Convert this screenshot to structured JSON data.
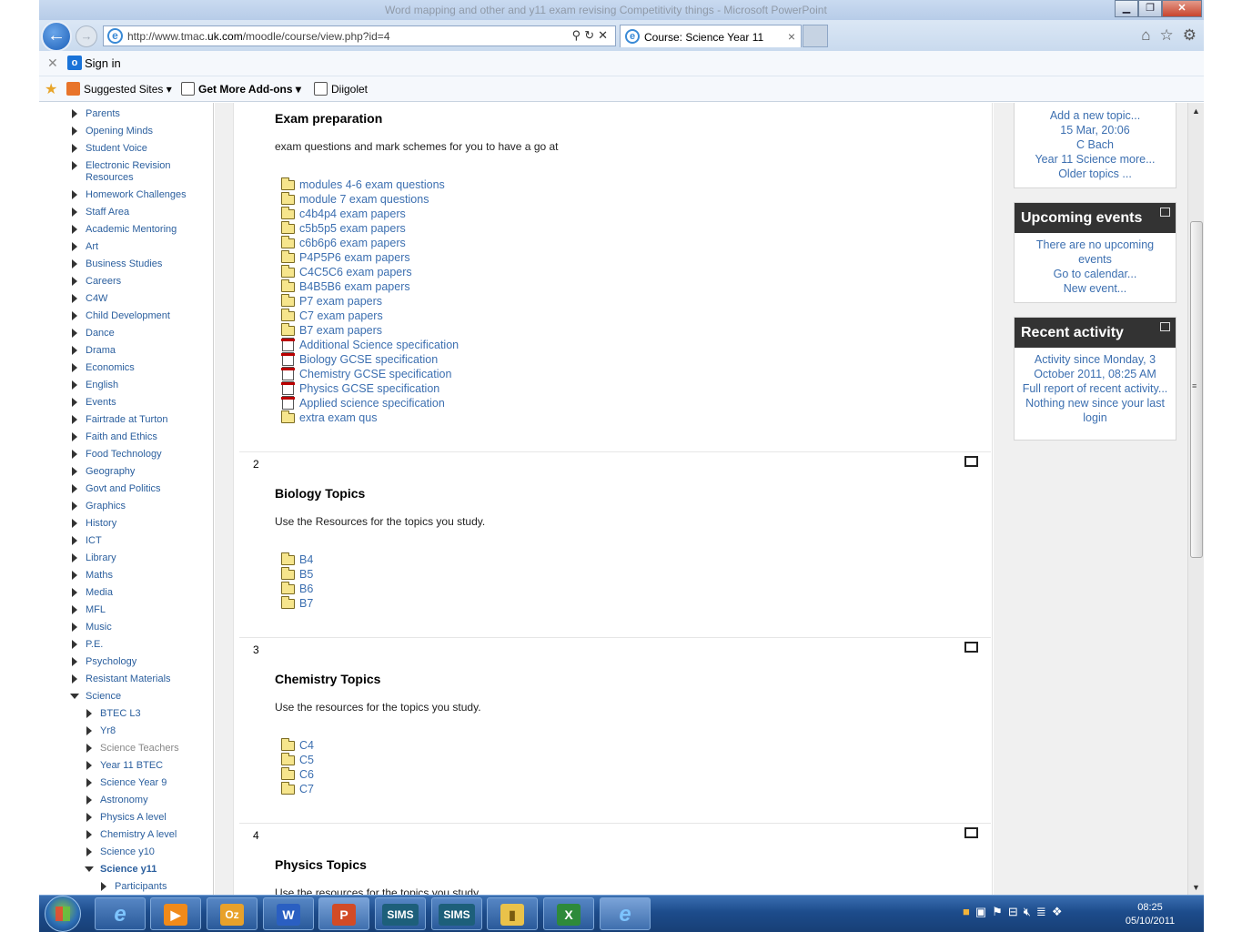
{
  "window": {
    "title": "Word mapping and other and y11 exam revising Competitivity things - Microsoft PowerPoint"
  },
  "browser": {
    "url_prefix": "http://www.tmac.",
    "url_domain": "uk.com",
    "url_suffix": "/moodle/course/view.php?id=4",
    "tab_label": "Course: Science Year 11"
  },
  "signin": {
    "label": "Sign in"
  },
  "favorites": {
    "suggested": "Suggested Sites",
    "addons": "Get More Add-ons",
    "diigolet": "Diigolet"
  },
  "sidebar": {
    "items": [
      "Parents",
      "Opening Minds",
      "Student Voice",
      "Electronic Revision",
      "Resources",
      "Homework Challenges",
      "Staff Area",
      "Academic Mentoring",
      "Art",
      "Business Studies",
      "Careers",
      "C4W",
      "Child Development",
      "Dance",
      "Drama",
      "Economics",
      "English",
      "Events",
      "Fairtrade at Turton",
      "Faith and Ethics",
      "Food Technology",
      "Geography",
      "Govt and Politics",
      "Graphics",
      "History",
      "ICT",
      "Library",
      "Maths",
      "Media",
      "MFL",
      "Music",
      "P.E.",
      "Psychology",
      "Resistant Materials",
      "Science"
    ],
    "science_children": [
      "BTEC L3",
      "Yr8",
      "Science Teachers",
      "Year 11 BTEC",
      "Science Year 9",
      "Astronomy",
      "Physics A level",
      "Chemistry A level",
      "Science y10",
      "Science y11"
    ],
    "y11_children": [
      "Participants"
    ]
  },
  "sections": {
    "exam": {
      "title": "Exam preparation",
      "desc": "exam questions and mark schemes for you to have a go at",
      "resources": [
        {
          "label": "modules 4-6 exam questions",
          "icon": "folder"
        },
        {
          "label": "module 7 exam questions",
          "icon": "folder"
        },
        {
          "label": "c4b4p4 exam papers",
          "icon": "folder"
        },
        {
          "label": "c5b5p5 exam papers",
          "icon": "folder"
        },
        {
          "label": "c6b6p6 exam papers",
          "icon": "folder"
        },
        {
          "label": "P4P5P6 exam papers",
          "icon": "folder"
        },
        {
          "label": "C4C5C6 exam papers",
          "icon": "folder"
        },
        {
          "label": "B4B5B6 exam papers",
          "icon": "folder"
        },
        {
          "label": "P7 exam papers",
          "icon": "folder"
        },
        {
          "label": "C7 exam papers",
          "icon": "folder"
        },
        {
          "label": "B7 exam papers",
          "icon": "folder"
        },
        {
          "label": "Additional Science specification",
          "icon": "pdf"
        },
        {
          "label": "Biology GCSE specification",
          "icon": "pdf"
        },
        {
          "label": "Chemistry GCSE specification",
          "icon": "pdf"
        },
        {
          "label": "Physics GCSE specification",
          "icon": "pdf"
        },
        {
          "label": "Applied science specification",
          "icon": "pdf"
        },
        {
          "label": "extra exam qus",
          "icon": "folder"
        }
      ]
    },
    "biology": {
      "number": "2",
      "title": "Biology Topics",
      "desc": "Use the Resources for the topics you study.",
      "resources": [
        "B4",
        "B5",
        "B6",
        "B7"
      ]
    },
    "chemistry": {
      "number": "3",
      "title": "Chemistry Topics",
      "desc": "Use the resources for the topics you study.",
      "resources": [
        "C4",
        "C5",
        "C6",
        "C7"
      ]
    },
    "physics": {
      "number": "4",
      "title": "Physics Topics",
      "desc": "Use the resources for the topics you study."
    }
  },
  "blocks": {
    "news": {
      "lines": [
        "Add a new topic...",
        "15 Mar, 20:06",
        "C Bach",
        "Year 11 Science more...",
        "Older topics ..."
      ]
    },
    "upcoming": {
      "title": "Upcoming events",
      "lines": [
        "There are no upcoming",
        "events",
        "Go to calendar...",
        "New event..."
      ]
    },
    "recent": {
      "title": "Recent activity",
      "lines": [
        "Activity since Monday, 3",
        "October 2011, 08:25 AM",
        "Full report of recent activity...",
        "Nothing new since your last",
        "login"
      ]
    }
  },
  "taskbar": {
    "apps": [
      {
        "name": "ie",
        "label": "e"
      },
      {
        "name": "media",
        "label": "▶"
      },
      {
        "name": "outlook",
        "label": "Oz"
      },
      {
        "name": "word",
        "label": "W"
      },
      {
        "name": "powerpoint",
        "label": "P"
      },
      {
        "name": "sims1",
        "label": "SIMS"
      },
      {
        "name": "sims2",
        "label": "SIMS"
      },
      {
        "name": "explorer",
        "label": "▮"
      },
      {
        "name": "excel",
        "label": "X"
      },
      {
        "name": "ie2",
        "label": "e"
      }
    ],
    "time": "08:25",
    "date": "05/10/2011"
  }
}
